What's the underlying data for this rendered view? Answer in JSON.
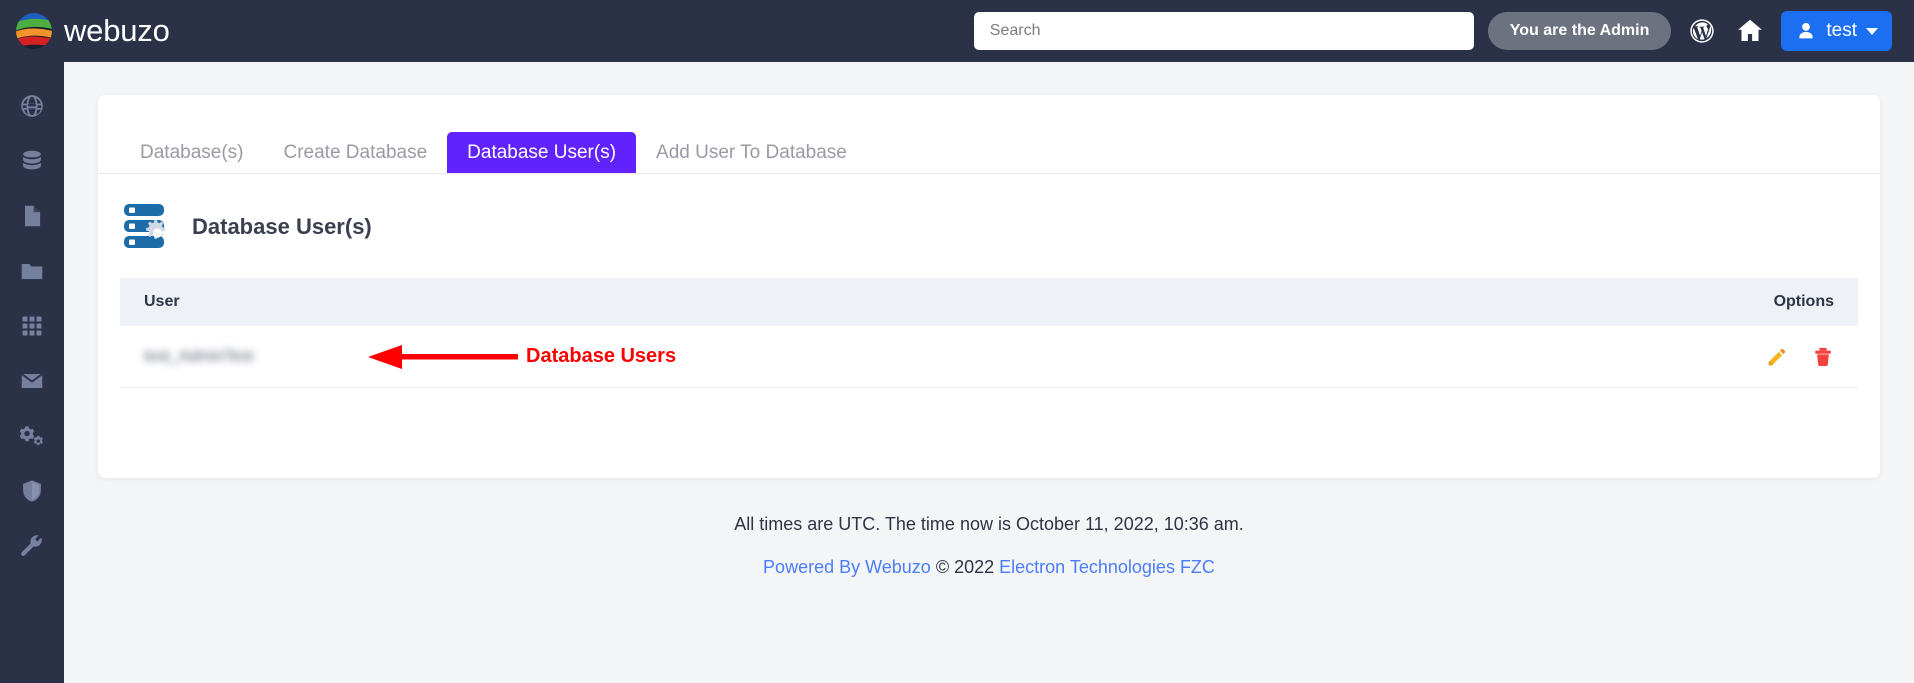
{
  "brand": {
    "name": "webuzo",
    "logo_icon": "webuzo-sphere-logo"
  },
  "header": {
    "search_placeholder": "Search",
    "search_value": "",
    "admin_badge": "You are the Admin",
    "wordpress_icon": "wordpress-icon",
    "home_icon": "home-icon",
    "user_icon": "user-icon",
    "username": "test",
    "caret_icon": "chevron-down-icon"
  },
  "sidebar": {
    "items": [
      {
        "icon": "globe-icon",
        "name": "domains"
      },
      {
        "icon": "database-icon",
        "name": "databases"
      },
      {
        "icon": "file-icon",
        "name": "files"
      },
      {
        "icon": "folder-icon",
        "name": "folders"
      },
      {
        "icon": "grid-apps-icon",
        "name": "apps"
      },
      {
        "icon": "envelope-icon",
        "name": "mail"
      },
      {
        "icon": "gears-icon",
        "name": "settings"
      },
      {
        "icon": "shield-icon",
        "name": "security"
      },
      {
        "icon": "wrench-icon",
        "name": "tools"
      }
    ]
  },
  "tabs": [
    {
      "label": "Database(s)",
      "active": false
    },
    {
      "label": "Create Database",
      "active": false
    },
    {
      "label": "Database User(s)",
      "active": true
    },
    {
      "label": "Add User To Database",
      "active": false
    }
  ],
  "section": {
    "icon": "database-server-gear-icon",
    "title": "Database User(s)"
  },
  "table": {
    "columns": [
      "User",
      "Options"
    ],
    "rows": [
      {
        "user": "test_AdminTest",
        "user_redacted": true,
        "edit_icon": "pencil-edit-icon",
        "delete_icon": "trash-delete-icon"
      }
    ]
  },
  "annotation": {
    "text": "Database Users",
    "arrow_icon": "left-arrow-annotation",
    "color": "#ff0000"
  },
  "footer": {
    "time_notice": "All times are UTC. The time now is October 11, 2022, 10:36 am.",
    "powered_by": "Powered By Webuzo",
    "copyright": "© 2022",
    "company": "Electron Technologies FZC"
  },
  "colors": {
    "sidebar_bg": "#2b3147",
    "accent_purple": "#6122fd",
    "accent_blue": "#1d6ff2",
    "link_blue": "#4a7dfb",
    "annotation_red": "#ff0000",
    "edit_orange": "#f5a623",
    "delete_red": "#f4433c"
  }
}
